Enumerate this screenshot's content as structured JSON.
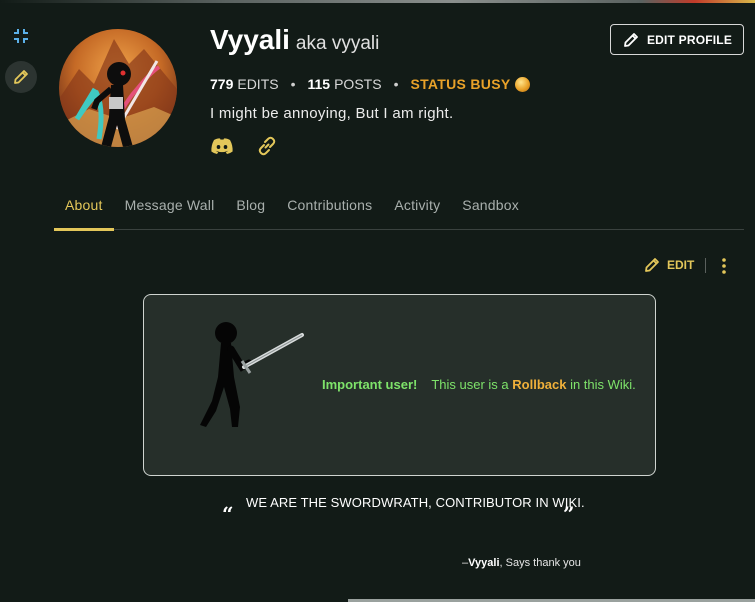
{
  "profile": {
    "username": "Vyyali",
    "aka": "aka vyyali",
    "edit_profile_label": "EDIT PROFILE",
    "edits_count": "779",
    "edits_label": "EDITS",
    "posts_count": "115",
    "posts_label": "POSTS",
    "status_text": "STATUS BUSY",
    "bio": "I might be annoying, But I am right."
  },
  "tabs": [
    {
      "label": "About"
    },
    {
      "label": "Message Wall"
    },
    {
      "label": "Blog"
    },
    {
      "label": "Contributions"
    },
    {
      "label": "Activity"
    },
    {
      "label": "Sandbox"
    }
  ],
  "toolbar": {
    "edit_label": "EDIT"
  },
  "userbox": {
    "important": "Important user!",
    "prefix": "This user is a ",
    "role": "Rollback",
    "suffix": " in this Wiki."
  },
  "quote": {
    "open_mark": "“",
    "text": "WE ARE THE SWORDWRATH, CONTRIBUTOR IN WIKI.",
    "close_mark": "”",
    "attribution_prefix": "–",
    "attribution_name": "Vyyali",
    "attribution_suffix": ", Says thank you"
  },
  "icons": {
    "collapse": "collapse-icon",
    "pencil": "pencil-icon",
    "discord": "discord-icon",
    "link": "link-icon",
    "more": "more-vertical-icon"
  },
  "colors": {
    "background": "#121b17",
    "accent": "#e3c75a",
    "status": "#e9a229",
    "userbox_green": "#7ee36a",
    "rollback_orange": "#f0b03a"
  }
}
